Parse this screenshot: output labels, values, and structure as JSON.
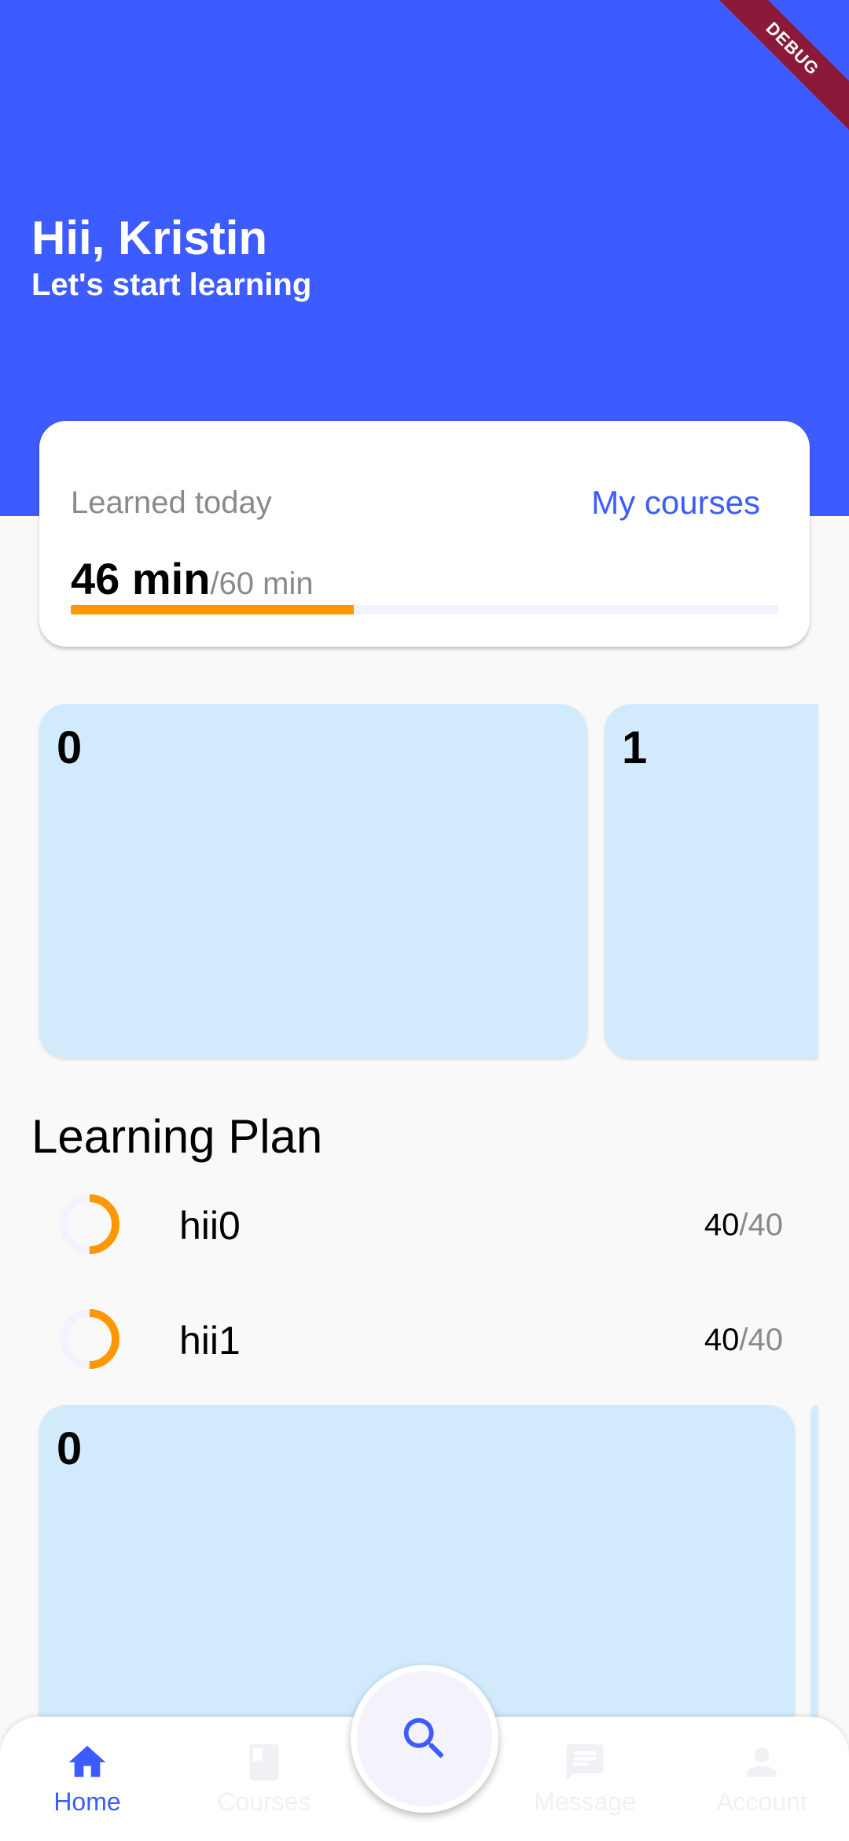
{
  "header": {
    "greeting": "Hii, Kristin",
    "subtitle": "Let's start learning",
    "debug_banner": "DEBUG",
    "background_color": "#3d5cff"
  },
  "learned_card": {
    "label": "Learned today",
    "link": "My courses",
    "value": "46 min",
    "total": "/60 min",
    "progress_fraction": 0.4,
    "progress_color": "#ff9800"
  },
  "carousel_top": [
    "0",
    "1"
  ],
  "learning_plan": {
    "title": "Learning Plan",
    "items": [
      {
        "title": "hii0",
        "done": "40",
        "total": "40",
        "ring_fraction": 0.5
      },
      {
        "title": "hii1",
        "done": "40",
        "total": "40",
        "ring_fraction": 0.5
      }
    ]
  },
  "carousel_bottom": [
    "0"
  ],
  "bottom_nav": {
    "items": [
      {
        "label": "Home",
        "icon": "home-icon",
        "active": true
      },
      {
        "label": "Courses",
        "icon": "book-icon",
        "active": false
      },
      {
        "label": "Message",
        "icon": "message-icon",
        "active": false
      },
      {
        "label": "Account",
        "icon": "person-icon",
        "active": false
      }
    ],
    "fab_icon": "search-icon",
    "active_color": "#3d5cff"
  }
}
